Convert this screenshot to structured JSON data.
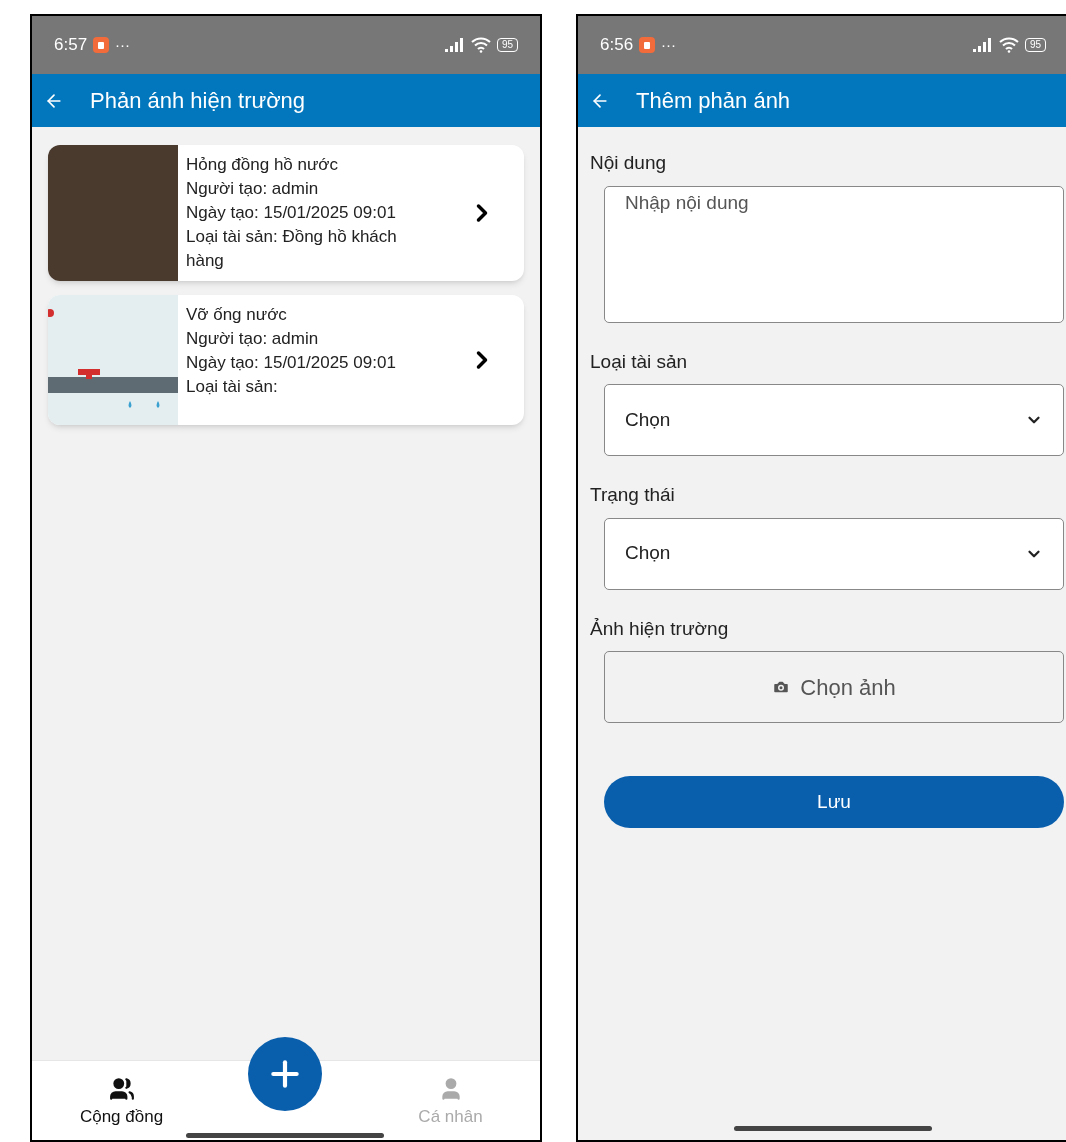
{
  "list_screen": {
    "status_bar": {
      "time": "6:57",
      "more": "···",
      "battery": "95"
    },
    "header": {
      "title": "Phản ánh hiện trường"
    },
    "reports": [
      {
        "kind": "meter",
        "title": "Hỏng đồng hồ nước",
        "creator": "Người tạo: admin",
        "date": "Ngày tạo: 15/01/2025 09:01",
        "asset_type": "Loại tài sản: Đồng hồ khách hàng"
      },
      {
        "kind": "pipe",
        "title": "Vỡ ống nước",
        "creator": "Người tạo: admin",
        "date": "Ngày tạo: 15/01/2025 09:01",
        "asset_type": "Loại tài sản:"
      }
    ],
    "bottom_nav": [
      {
        "kind": "community",
        "label": "Cộng đồng",
        "selected": true
      },
      {
        "kind": "personal",
        "label": "Cá nhân",
        "selected": false
      }
    ]
  },
  "form_screen": {
    "status_bar": {
      "time": "6:56",
      "more": "···",
      "battery": "95"
    },
    "header": {
      "title": "Thêm phản ánh"
    },
    "fields": [
      {
        "kind": "textarea",
        "label": "Nội dung",
        "placeholder": "Nhập nội dung"
      },
      {
        "kind": "select",
        "label": "Loại tài sản",
        "value": "Chọn"
      },
      {
        "kind": "select",
        "label": "Trạng thái",
        "value": "Chọn"
      },
      {
        "kind": "image",
        "label": "Ảnh hiện trường",
        "button": "Chọn ảnh"
      }
    ],
    "save_button": "Lưu"
  }
}
